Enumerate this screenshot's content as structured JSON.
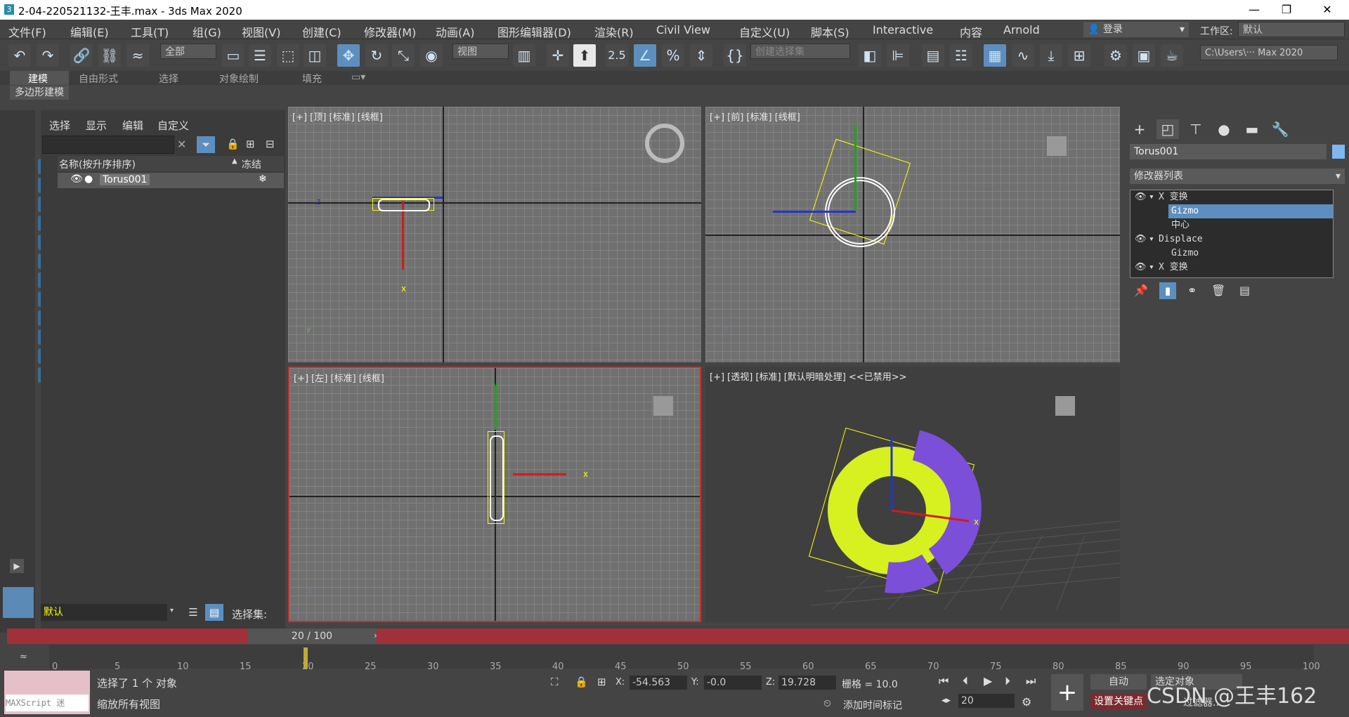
{
  "window": {
    "title": "2-04-220521132-王丰.max - 3ds Max 2020",
    "min": "—",
    "restore": "❐",
    "close": "✕"
  },
  "menu": [
    "文件(F)",
    "编辑(E)",
    "工具(T)",
    "组(G)",
    "视图(V)",
    "创建(C)",
    "修改器(M)",
    "动画(A)",
    "图形编辑器(D)",
    "渲染(R)",
    "Civil View",
    "自定义(U)",
    "脚本(S)",
    "Interactive",
    "内容",
    "Arnold"
  ],
  "account": {
    "login": "登录",
    "workspace_label": "工作区:",
    "workspace": "默认"
  },
  "toolbar": {
    "selection_filter": "全部",
    "ref_coord": "视图",
    "named_sel": "创建选择集",
    "snap_label": "2.5",
    "path": "C:\\Users\\··· Max 2020"
  },
  "ribbon": {
    "tabs": [
      "建模",
      "自由形式",
      "选择",
      "对象绘制",
      "填充"
    ],
    "subtab": "多边形建模"
  },
  "scene": {
    "menus": [
      "选择",
      "显示",
      "编辑",
      "自定义"
    ],
    "col_name": "名称(按升序排序)",
    "col_freeze": "冻结",
    "object": "Torus001",
    "layer": "默认",
    "selset": "选择集:"
  },
  "viewports": {
    "top": "[+] [顶] [标准] [线框]",
    "front": "[+] [前] [标准] [线框]",
    "left": "[+] [左] [标准] [线框]",
    "persp": "[+] [透视] [标准] [默认明暗处理] <<已禁用>>",
    "axis": {
      "x": "x",
      "y": "y",
      "z": "z"
    }
  },
  "command": {
    "obj_name": "Torus001",
    "mod_list": "修改器列表",
    "stack": [
      "X 变换",
      "Gizmo",
      "中心",
      "Displace",
      "Gizmo",
      "X 变换"
    ]
  },
  "timeline": {
    "frame": "20 / 100",
    "ticks": [
      "0",
      "5",
      "10",
      "15",
      "20",
      "25",
      "30",
      "35",
      "40",
      "45",
      "50",
      "55",
      "60",
      "65",
      "70",
      "75",
      "80",
      "85",
      "90",
      "95",
      "100"
    ]
  },
  "status": {
    "maxscript": "MAXScript 迷",
    "selected": "选择了 1 个 对象",
    "prompt": "缩放所有视图",
    "x_label": "X:",
    "x": "-54.563",
    "y_label": "Y:",
    "y": "-0.0",
    "z_label": "Z:",
    "z": "19.728",
    "grid": "栅格 = 10.0",
    "add_time_tag": "添加时间标记",
    "auto": "自动",
    "set_key": "设置关键点",
    "sel_obj": "选定对象",
    "filter": "过滤器...",
    "frame": "20",
    "watermark": "CSDN @王丰162"
  },
  "colors": {
    "timebar": "#a1303a",
    "torus_yellow": "#d7f020",
    "torus_purple": "#7b4fd8"
  }
}
